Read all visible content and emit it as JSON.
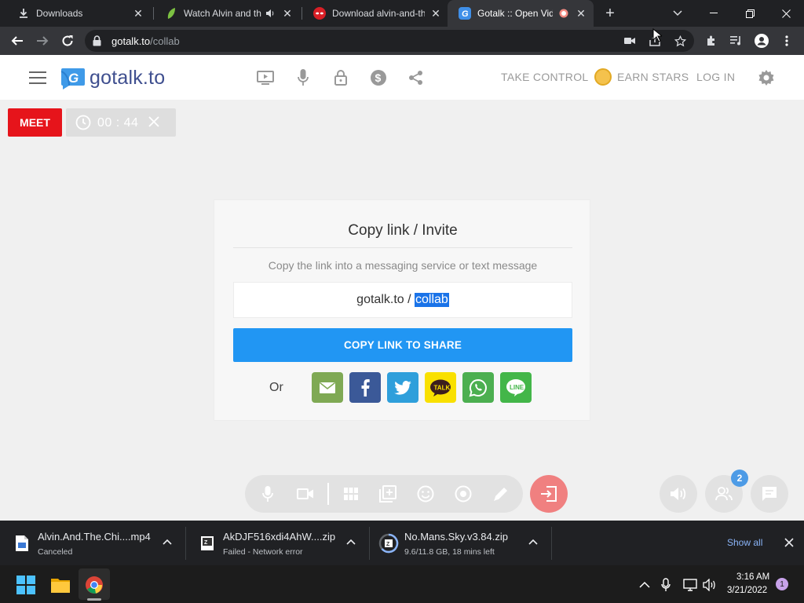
{
  "browser": {
    "tabs": [
      {
        "title": "Downloads",
        "icon": "download-icon"
      },
      {
        "title": "Watch Alvin and th",
        "icon": "leaf-icon",
        "audio": true
      },
      {
        "title": "Download alvin-and-th",
        "icon": "mask-icon"
      },
      {
        "title": "Gotalk :: Open Vide",
        "icon": "gotalk-icon",
        "recording": true,
        "active": true
      }
    ],
    "url_host": "gotalk.to",
    "url_path": "/collab"
  },
  "site": {
    "logo_text": "gotalk.to",
    "nav": {
      "take_control": "TAKE CONTROL",
      "earn_stars": "EARN STARS",
      "log_in": "LOG IN"
    },
    "meet_label": "MEET",
    "timer": "00 : 44"
  },
  "invite": {
    "title": "Copy link / Invite",
    "subtitle": "Copy the link into a messaging service or text message",
    "link_prefix": "gotalk.to / ",
    "link_room": "collab",
    "copy_button": "COPY LINK TO SHARE",
    "or_label": "Or",
    "share_targets": [
      {
        "name": "email",
        "color": "#7fa954"
      },
      {
        "name": "facebook",
        "color": "#3b5998"
      },
      {
        "name": "twitter",
        "color": "#2f9fdb"
      },
      {
        "name": "kakaotalk",
        "color": "#f9e000",
        "label": "TALK"
      },
      {
        "name": "whatsapp",
        "color": "#4caf50"
      },
      {
        "name": "line",
        "color": "#43b649",
        "label": "LINE"
      }
    ]
  },
  "controls": {
    "participants_count": "2"
  },
  "downloads": [
    {
      "name": "Alvin.And.The.Chi....mp4",
      "status": "Canceled"
    },
    {
      "name": "AkDJF516xdi4AhW....zip",
      "status": "Failed - Network error"
    },
    {
      "name": "No.Mans.Sky.v3.84.zip",
      "status": "9.6/11.8 GB, 18 mins left"
    }
  ],
  "shelf": {
    "show_all": "Show all"
  },
  "taskbar": {
    "time": "3:16 AM",
    "date": "3/21/2022",
    "notifications": "1"
  }
}
